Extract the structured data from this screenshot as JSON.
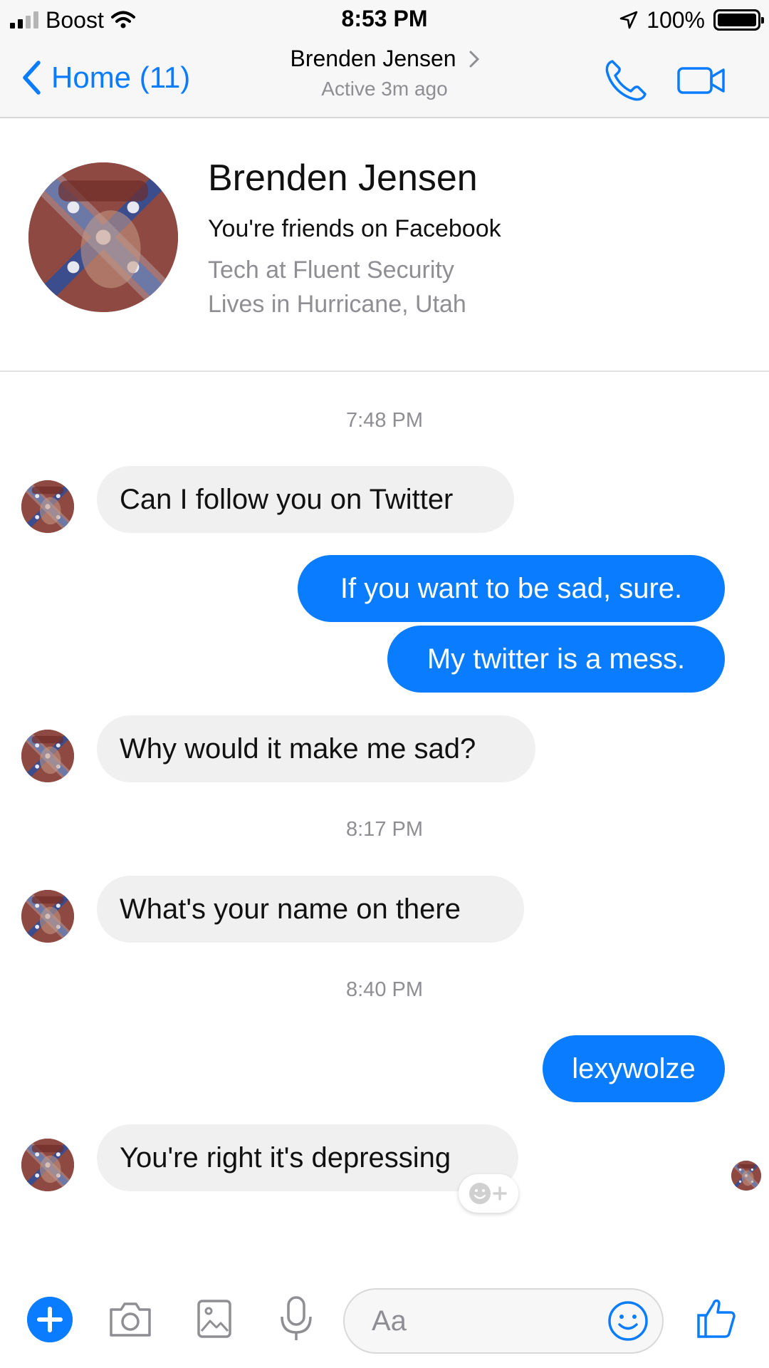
{
  "status_bar": {
    "carrier": "Boost",
    "time": "8:53 PM",
    "battery": "100%"
  },
  "nav": {
    "back_label": "Home (11)",
    "contact_name": "Brenden Jensen",
    "active_status": "Active 3m ago"
  },
  "profile": {
    "name": "Brenden Jensen",
    "friendship": "You're friends on Facebook",
    "work": "Tech at Fluent Security",
    "location": "Lives in Hurricane, Utah"
  },
  "messages": [
    {
      "kind": "timestamp",
      "text": "7:48 PM"
    },
    {
      "kind": "incoming",
      "text": "Can I follow you on Twitter"
    },
    {
      "kind": "outgoing",
      "text": "If you want to be sad, sure."
    },
    {
      "kind": "outgoing",
      "text": "My twitter is a mess."
    },
    {
      "kind": "incoming",
      "text": "Why would it make me sad?"
    },
    {
      "kind": "timestamp",
      "text": "8:17 PM"
    },
    {
      "kind": "incoming",
      "text": "What's your name on there"
    },
    {
      "kind": "timestamp",
      "text": "8:40 PM"
    },
    {
      "kind": "outgoing",
      "text": "lexywolze"
    },
    {
      "kind": "incoming",
      "text": "You're right it's depressing"
    }
  ],
  "composer": {
    "placeholder": "Aa"
  },
  "icons": {
    "back": "chevron-left-icon",
    "call": "phone-icon",
    "video": "video-camera-icon",
    "add": "plus-icon",
    "camera": "camera-icon",
    "gallery": "image-icon",
    "voice": "microphone-icon",
    "emoji": "smiley-icon",
    "like": "thumbs-up-icon",
    "react": "add-reaction-icon"
  },
  "colors": {
    "accent": "#0a7cff",
    "incoming_bubble": "#f0f0f0",
    "secondary_text": "#8e8e93"
  }
}
